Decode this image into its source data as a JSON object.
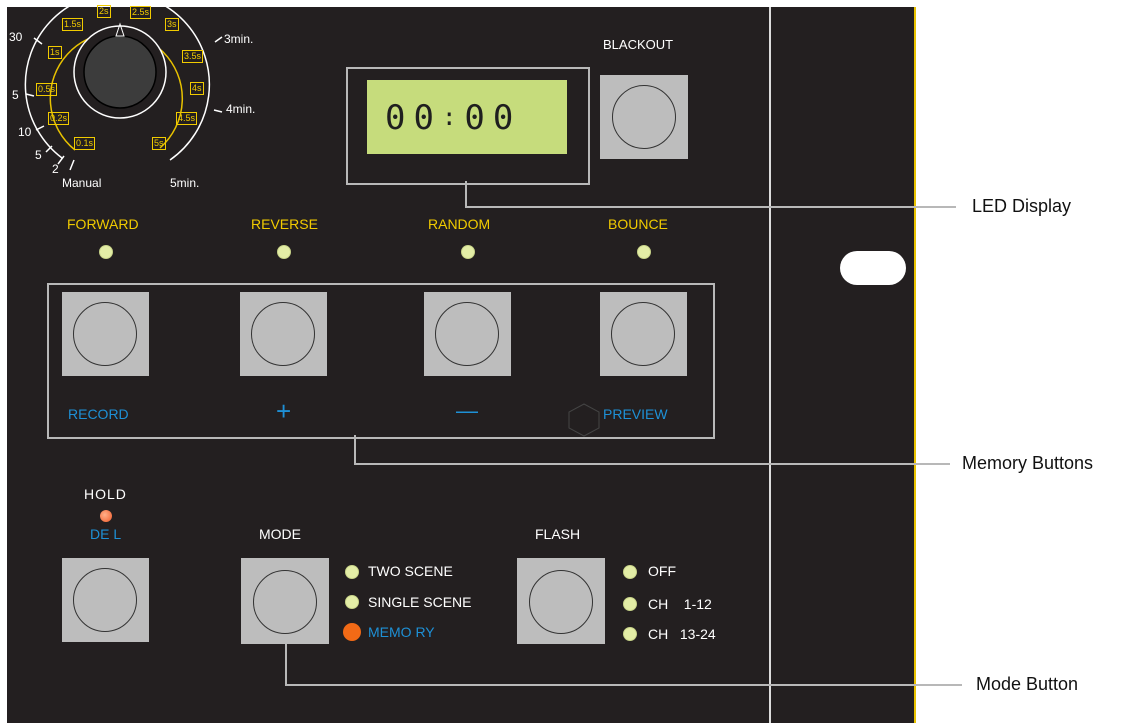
{
  "dial": {
    "inner_labels": [
      "1.5s",
      "2s",
      "2.5s",
      "3s",
      "1s",
      "3.5s",
      "0.5s",
      "4s",
      "0.2s",
      "4.5s",
      "0.1s",
      "5s"
    ],
    "outer_labels": [
      "30",
      "3min.",
      "5",
      "4min.",
      "10",
      "5",
      "2",
      "Manual",
      "5min."
    ]
  },
  "display": {
    "value": "00:00",
    "digits": [
      "0",
      "0",
      ":",
      "0",
      "0"
    ]
  },
  "blackout": {
    "label": "BLACKOUT"
  },
  "modes": {
    "forward": "FORWARD",
    "reverse": "REVERSE",
    "random": "RANDOM",
    "bounce": "BOUNCE"
  },
  "memory": {
    "record": "RECORD",
    "plus": "+",
    "minus": "—",
    "preview": "PREVIEW"
  },
  "hold": {
    "label": "HOLD",
    "del": "DE L"
  },
  "mode_button": {
    "label": "MODE",
    "options": [
      "TWO  SCENE",
      "SINGLE  SCENE",
      "MEMO RY"
    ]
  },
  "flash": {
    "label": "FLASH",
    "options": [
      "OFF",
      "CH    1-12",
      "CH   13-24"
    ]
  },
  "callouts": {
    "led_display": "LED Display",
    "memory_buttons": "Memory Buttons",
    "mode_button": "Mode Button"
  },
  "colors": {
    "panel": "#231f20",
    "label_yellow": "#f1cb00",
    "label_blue": "#1e90d6",
    "lcd": "#c6dc7c",
    "led_orange": "#f26a16"
  }
}
